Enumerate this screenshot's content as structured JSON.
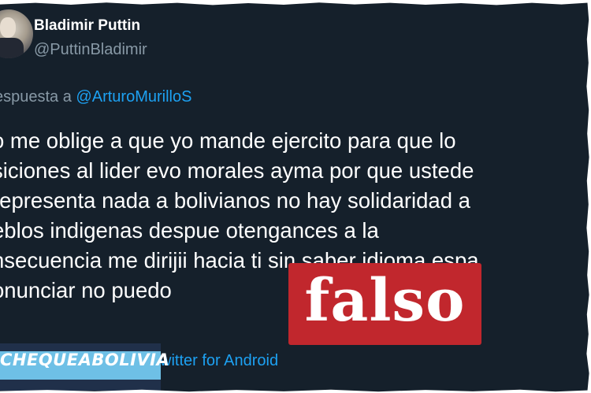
{
  "author": {
    "display_name": "Bladimir Puttin",
    "handle": "@PuttinBladimir"
  },
  "reply": {
    "prefix": "espuesta a ",
    "mention": "@ArturoMurilloS"
  },
  "tweet": {
    "lines": [
      "o me oblige a que yo mande ejercito para que lo",
      "siciones al lider evo morales ayma por que ustede",
      " representa nada a bolivianos no hay solidaridad a",
      "eblos indigenas despue otengances a la",
      "nsecuencia me dirijii hacia ti sin saber idioma espa",
      "onunciar no puedo"
    ]
  },
  "source": {
    "via": "witter for Android"
  },
  "brand": {
    "name": "CHEQUEABOLIVIA"
  },
  "verdict": {
    "label": "falso"
  },
  "colors": {
    "background": "#15202b",
    "link": "#1da1f2",
    "muted": "#8899a6",
    "verdict": "#c1272d",
    "brand_bar": "#6ec0e6",
    "brand_bg": "#20304a"
  }
}
